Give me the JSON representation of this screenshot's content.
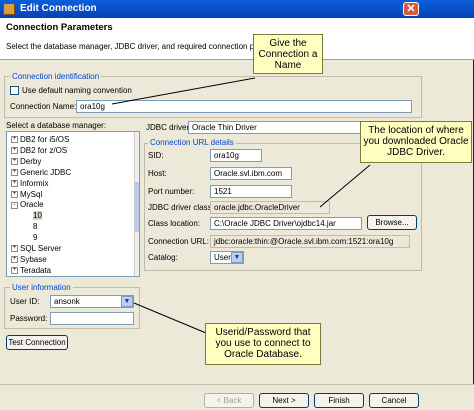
{
  "window": {
    "title": "Edit Connection",
    "close": "✕"
  },
  "header": {
    "title": "Connection Parameters",
    "description": "Select the database manager, JDBC driver, and required connection param"
  },
  "identification": {
    "group_label": "Connection identification",
    "default_naming_label": "Use default naming convention",
    "default_naming_checked": false,
    "name_label": "Connection Name:",
    "name_value": "ora10g"
  },
  "db_manager": {
    "label": "Select a database manager:",
    "items": [
      {
        "label": "DB2 for i5/OS",
        "expander": "+",
        "level": 0
      },
      {
        "label": "DB2 for z/OS",
        "expander": "+",
        "level": 0
      },
      {
        "label": "Derby",
        "expander": "+",
        "level": 0
      },
      {
        "label": "Generic JDBC",
        "expander": "+",
        "level": 0
      },
      {
        "label": "Informix",
        "expander": "+",
        "level": 0
      },
      {
        "label": "MySql",
        "expander": "+",
        "level": 0
      },
      {
        "label": "Oracle",
        "expander": "-",
        "level": 0
      },
      {
        "label": "10",
        "expander": "",
        "level": 1,
        "selected": true
      },
      {
        "label": "8",
        "expander": "",
        "level": 1
      },
      {
        "label": "9",
        "expander": "",
        "level": 1
      },
      {
        "label": "SQL Server",
        "expander": "+",
        "level": 0
      },
      {
        "label": "Sybase",
        "expander": "+",
        "level": 0
      },
      {
        "label": "Teradata",
        "expander": "+",
        "level": 0
      }
    ]
  },
  "driver": {
    "label": "JDBC driver:",
    "value": "Oracle Thin Driver"
  },
  "url_details": {
    "group_label": "Connection URL details",
    "sid_label": "SID:",
    "sid_value": "ora10g",
    "host_label": "Host:",
    "host_value": "Oracle.svl.ibm.com",
    "port_label": "Port number:",
    "port_value": "1521",
    "driver_class_label": "JDBC driver class:",
    "driver_class_value": "oracle.jdbc.OracleDriver",
    "class_location_label": "Class location:",
    "class_location_value": "C:\\Oracle JDBC Driver\\ojdbc14.jar",
    "browse_label": "Browse...",
    "url_label": "Connection URL:",
    "url_value": "jdbc:oracle:thin:@Oracle.svl.ibm.com:1521:ora10g",
    "catalog_label": "Catalog:",
    "catalog_value": "User"
  },
  "user_info": {
    "group_label": "User information",
    "user_label": "User ID:",
    "user_value": "ansonk",
    "password_label": "Password:",
    "password_value": ""
  },
  "buttons": {
    "test": "Test Connection",
    "back": "< Back",
    "next": "Next >",
    "finish": "Finish",
    "cancel": "Cancel"
  },
  "callouts": {
    "name": "Give the Connection a Name",
    "driver": "The location of where you downloaded Oracle JDBC Driver.",
    "credentials": "Userid/Password that you use to connect to Oracle Database."
  }
}
